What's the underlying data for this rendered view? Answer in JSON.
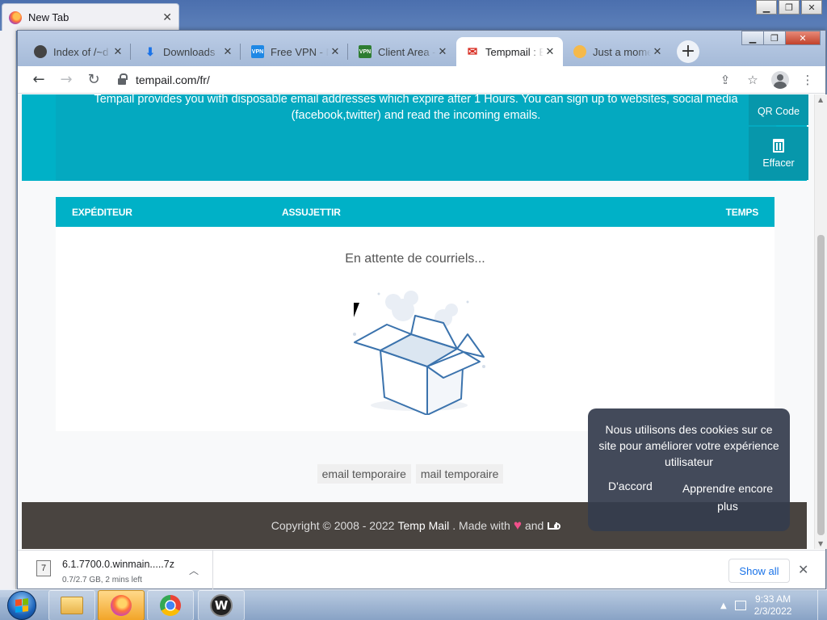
{
  "firefox": {
    "tab_title": "New Tab"
  },
  "browser": {
    "tabs": [
      {
        "label": "Index of /~d",
        "icon": "index-favicon"
      },
      {
        "label": "Downloads",
        "icon": "download-favicon"
      },
      {
        "label": "Free VPN - N",
        "icon": "vpn-favicon"
      },
      {
        "label": "Client Area -",
        "icon": "vpn-favicon"
      },
      {
        "label": "Tempmail : E",
        "icon": "gmail-favicon",
        "active": true
      },
      {
        "label": "Just a mome",
        "icon": "cloud-favicon"
      }
    ],
    "url": "tempail.com/fr/"
  },
  "page": {
    "hero_text": "Tempail provides you with disposable email addresses which expire after 1 Hours. You can sign up to websites, social media (facebook,twitter) and read the incoming emails.",
    "qr_label": "QR Code",
    "delete_label": "Effacer",
    "inbox_columns": {
      "from": "EXPÉDITEUR",
      "subject": "ASSUJETTIR",
      "time": "TEMPS"
    },
    "waiting_text": "En attente de courriels...",
    "tags": [
      "email temporaire",
      "mail temporaire"
    ],
    "footer": {
      "copyright": "Copyright © 2008 - 2022",
      "brand": "Temp Mail",
      "made_with": ". Made with",
      "and": "and"
    },
    "cookie": {
      "text": "Nous utilisons des cookies sur ce site pour améliorer votre expérience utilisateur",
      "accept": "D'accord",
      "learn_more": "Apprendre encore plus"
    }
  },
  "downloads": {
    "filename": "6.1.7700.0.winmain.....7z",
    "status": "0.7/2.7 GB, 2 mins left",
    "show_all": "Show all"
  },
  "taskbar": {
    "time": "9:33 AM",
    "date": "2/3/2022"
  },
  "colors": {
    "accent": "#00b1c7",
    "footer_bg": "#494440",
    "link_blue": "#1a73e8"
  }
}
